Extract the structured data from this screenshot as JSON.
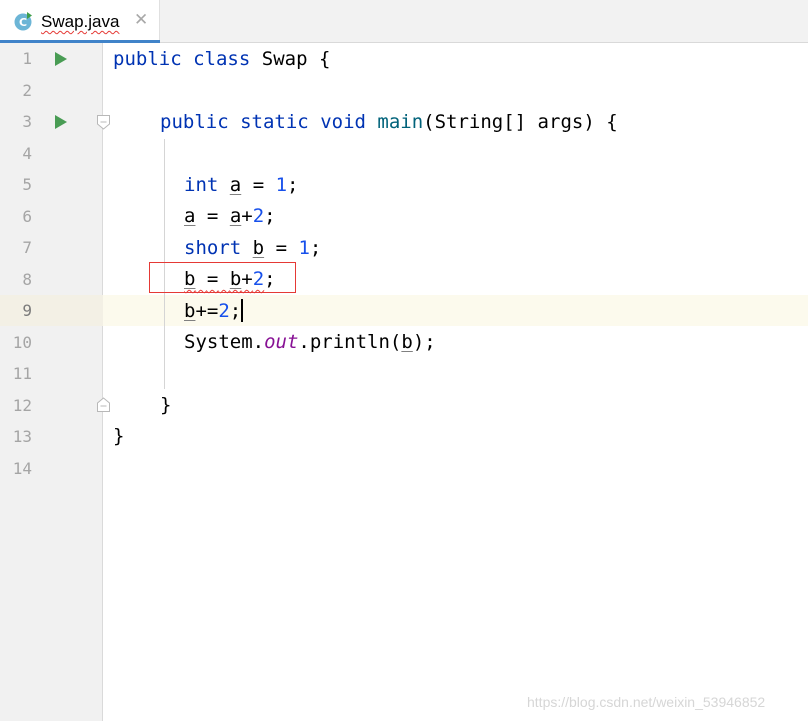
{
  "tab": {
    "filename": "Swap.java",
    "close_glyph": "✕",
    "icon": "java-class-icon",
    "icon_letter": "C"
  },
  "line_numbers": [
    "1",
    "2",
    "3",
    "4",
    "5",
    "6",
    "7",
    "8",
    "9",
    "10",
    "11",
    "12",
    "13",
    "14"
  ],
  "current_line": "9",
  "code": {
    "line1": {
      "kw1": "public",
      "kw2": "class",
      "name": "Swap",
      "brace": "{"
    },
    "line3": {
      "kw1": "public",
      "kw2": "static",
      "kw3": "void",
      "method": "main",
      "params_open": "(String[] args)",
      "brace": "{"
    },
    "line5": {
      "type": "int",
      "var": "a",
      "op": "=",
      "val": "1",
      "semi": ";"
    },
    "line6": {
      "var1": "a",
      "op": "=",
      "var2": "a",
      "plus": "+",
      "val": "2",
      "semi": ";"
    },
    "line7": {
      "type": "short",
      "var": "b",
      "op": "=",
      "val": "1",
      "semi": ";"
    },
    "line8": {
      "var1": "b",
      "op": "=",
      "var2": "b",
      "plus": "+",
      "val": "2",
      "semi": ";"
    },
    "line9": {
      "var": "b",
      "op": "+=",
      "val": "2",
      "semi": ";"
    },
    "line10": {
      "obj": "System.",
      "field": "out",
      "method": ".println(",
      "var": "b",
      "close": ");"
    },
    "line12": {
      "brace": "}"
    },
    "line13": {
      "brace": "}"
    }
  },
  "watermark": "https://blog.csdn.net/weixin_53946852",
  "colors": {
    "keyword": "#0033b3",
    "number": "#1750eb",
    "static_field": "#871094",
    "error": "#e53935",
    "tab_accent": "#4083c9",
    "run_icon": "#499c54"
  }
}
